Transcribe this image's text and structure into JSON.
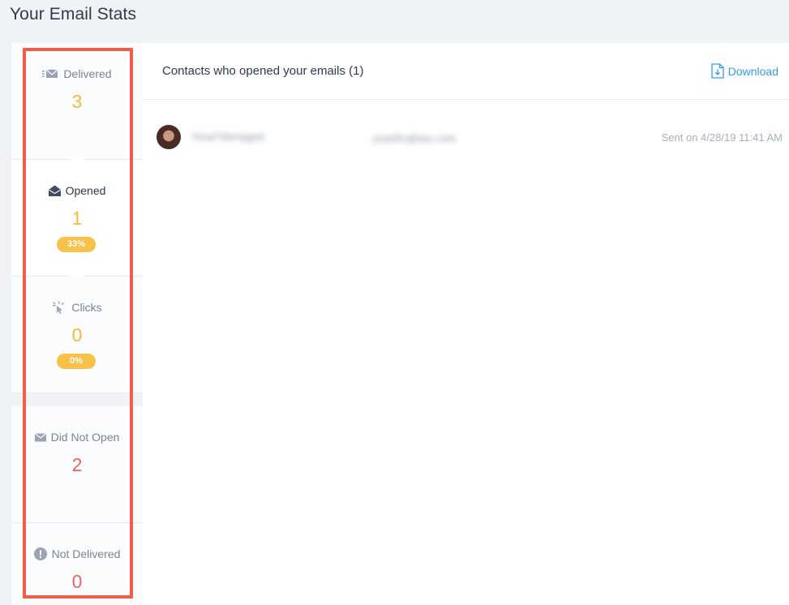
{
  "page": {
    "title": "Your Email Stats"
  },
  "stats": [
    {
      "label": "Delivered",
      "count": "3",
      "icon": "delivered-icon"
    },
    {
      "label": "Opened",
      "count": "1",
      "percent": "33%",
      "icon": "envelope-open-icon"
    },
    {
      "label": "Clicks",
      "count": "0",
      "percent": "0%",
      "icon": "click-icon"
    },
    {
      "label": "Did Not Open",
      "count": "2",
      "icon": "envelope-closed-icon"
    },
    {
      "label": "Not Delivered",
      "count": "0",
      "icon": "alert-icon"
    }
  ],
  "main": {
    "title": "Contacts who opened your emails (1)",
    "download_label": "Download",
    "rows": [
      {
        "name": "Yosef Menaged",
        "email": "yosefm@wix.com",
        "sent": "Sent on 4/28/19 11:41 AM"
      }
    ]
  },
  "colors": {
    "accent_blue": "#3899ec",
    "count_yellow": "#f5b93d",
    "count_red": "#ee6464",
    "highlight": "#f45d4c"
  }
}
